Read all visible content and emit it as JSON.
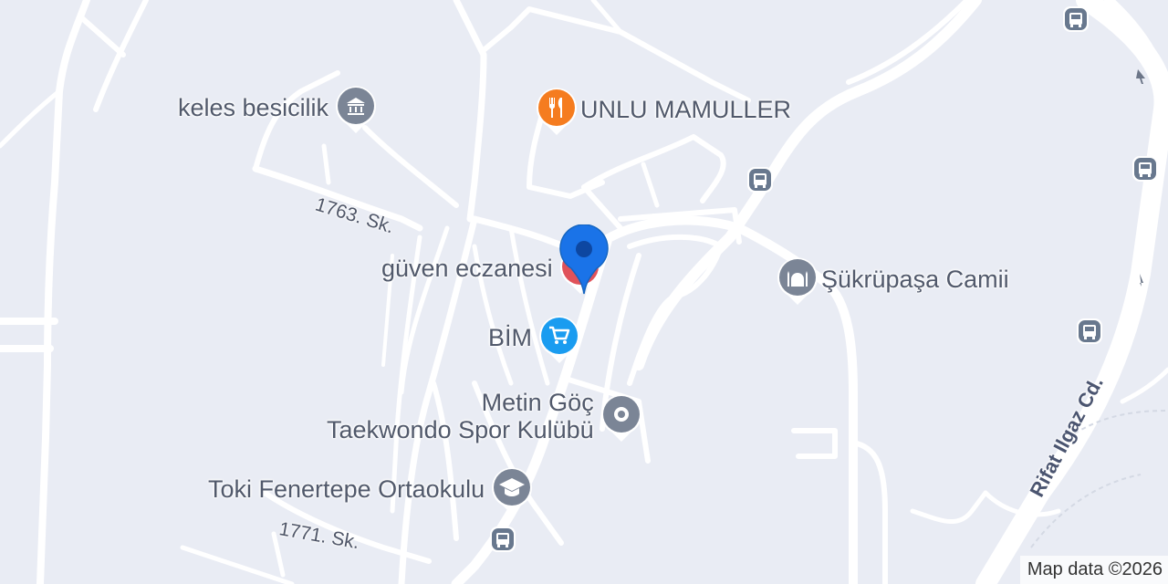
{
  "pois": {
    "keles": {
      "label": "keles besicilik",
      "icon": "building-icon",
      "color": "#7b8596"
    },
    "unlu": {
      "label": "UNLU MAMULLER",
      "icon": "fork-knife-icon",
      "color": "#f57c1f"
    },
    "guven": {
      "label": "güven eczanesi",
      "icon": "pharmacy-icon",
      "color": "#e0525a"
    },
    "sukrupasa": {
      "label": "Şükrüpaşa Camii",
      "icon": "mosque-icon",
      "color": "#7b8596"
    },
    "bim": {
      "label": "BİM",
      "icon": "shopping-cart-icon",
      "color": "#1a9cf0"
    },
    "metin": {
      "label_line1": "Metin Göç",
      "label_line2": "Taekwondo Spor Kulübü",
      "icon": "place-icon",
      "color": "#7b8596"
    },
    "toki": {
      "label": "Toki Fenertepe Ortaokulu",
      "icon": "school-icon",
      "color": "#7b8596"
    }
  },
  "streets": {
    "s1763": "1763. Sk.",
    "s1771": "1771. Sk.",
    "rifat": "Rifat Ilgaz Cd."
  },
  "selected_marker": {
    "icon": "location-pin-icon",
    "color": "#1a73e8"
  },
  "bus_stop_icon": "bus-icon",
  "attribution": "Map data ©2026"
}
